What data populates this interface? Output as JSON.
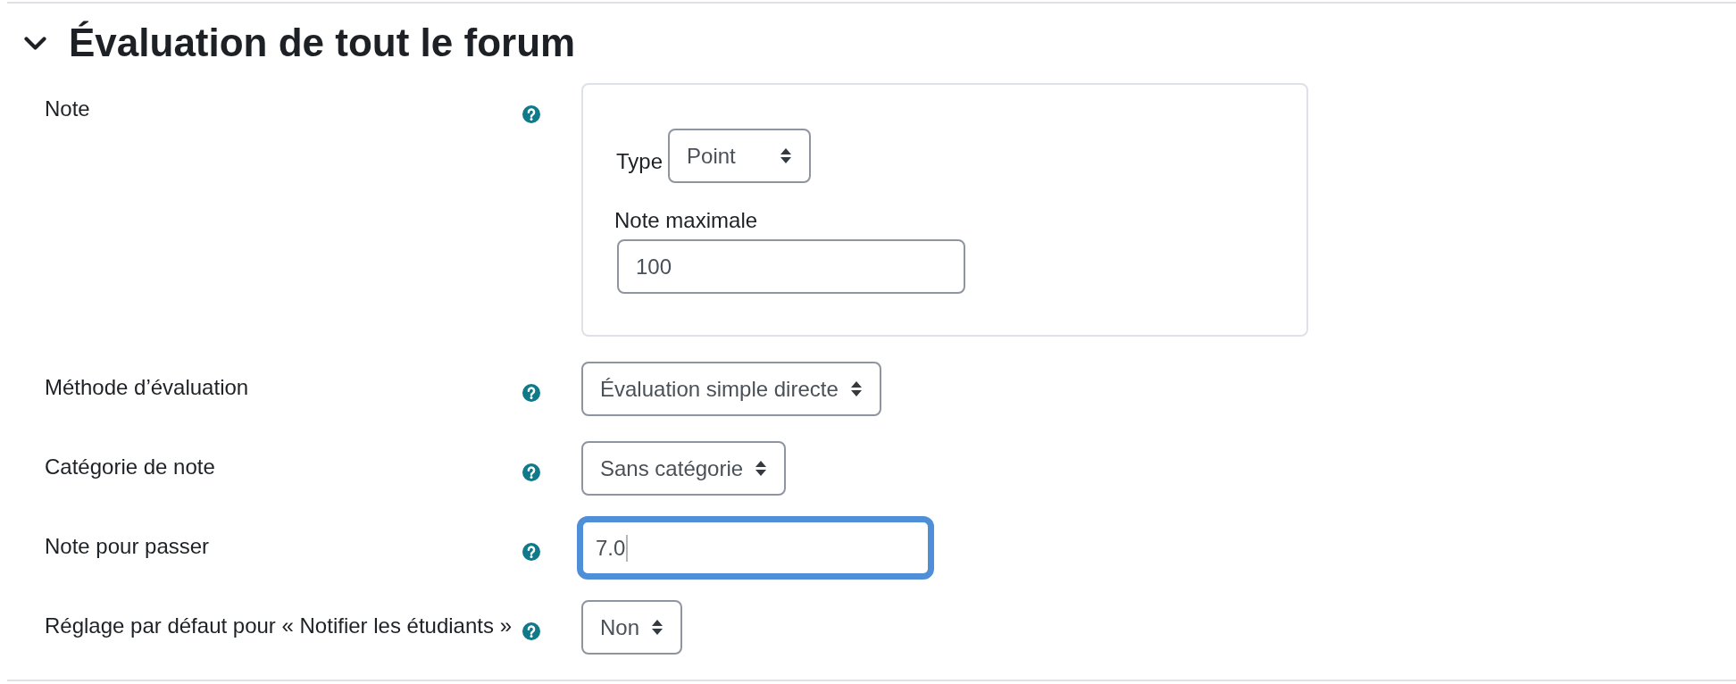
{
  "section": {
    "title": "Évaluation de tout le forum",
    "expanded": true
  },
  "fields": [
    {
      "kind": "group",
      "label": "Note",
      "controls": [
        {
          "kind": "select",
          "label": "Type",
          "value": "Point"
        },
        {
          "kind": "input",
          "label": "Note maximale",
          "value": "100",
          "focused": false
        }
      ]
    },
    {
      "kind": "select",
      "label": "Méthode d’évaluation",
      "value": "Évaluation simple directe"
    },
    {
      "kind": "select",
      "label": "Catégorie de note",
      "value": "Sans catégorie"
    },
    {
      "kind": "input",
      "label": "Note pour passer",
      "value": "7.0",
      "focused": true
    },
    {
      "kind": "select",
      "label": "Réglage par défaut pour « Notifier les étudiants »",
      "value": "Non"
    }
  ]
}
